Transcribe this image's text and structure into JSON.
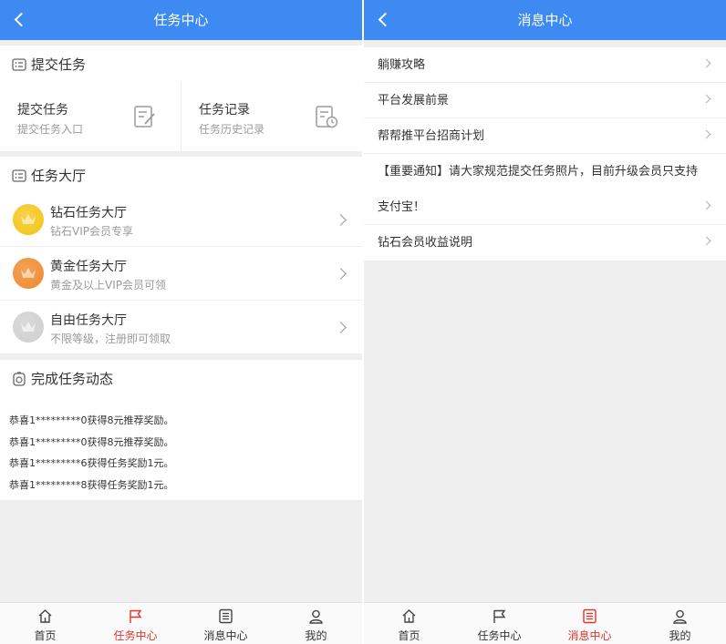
{
  "left": {
    "header": {
      "title": "任务中心"
    },
    "submit_section": {
      "title": "提交任务",
      "cells": [
        {
          "title": "提交任务",
          "subtitle": "提交任务入口",
          "icon": "edit-document-icon"
        },
        {
          "title": "任务记录",
          "subtitle": "任务历史记录",
          "icon": "history-document-icon"
        }
      ]
    },
    "hall_section": {
      "title": "任务大厅",
      "items": [
        {
          "title": "钻石任务大厅",
          "subtitle": "钻石VIP会员专享",
          "color": "#f5c518"
        },
        {
          "title": "黄金任务大厅",
          "subtitle": "黄金及以上VIP会员可领",
          "color": "#ee8a2c"
        },
        {
          "title": "自由任务大厅",
          "subtitle": "不限等级，注册即可领取",
          "color": "#cfcfcf"
        }
      ]
    },
    "activity_section": {
      "title": "完成任务动态",
      "lines": [
        "恭喜1*********0获得8元推荐奖励。",
        "恭喜1*********0获得8元推荐奖励。",
        "恭喜1*********6获得任务奖励1元。",
        "恭喜1*********8获得任务奖励1元。"
      ]
    },
    "tabbar": {
      "active": 1
    }
  },
  "right": {
    "header": {
      "title": "消息中心"
    },
    "messages": [
      "躺赚攻略",
      "平台发展前景",
      "帮帮推平台招商计划",
      "【重要通知】请大家规范提交任务照片，目前升级会员只支持",
      "支付宝！",
      "钻石会员收益说明"
    ],
    "tabbar": {
      "active": 2
    }
  },
  "tabs": [
    {
      "label": "首页",
      "icon": "home-icon"
    },
    {
      "label": "任务中心",
      "icon": "flag-icon"
    },
    {
      "label": "消息中心",
      "icon": "message-list-icon"
    },
    {
      "label": "我的",
      "icon": "user-icon"
    }
  ],
  "colors": {
    "header": "#3d8bf2",
    "active_tab": "#e5332a",
    "background": "#efefef"
  }
}
